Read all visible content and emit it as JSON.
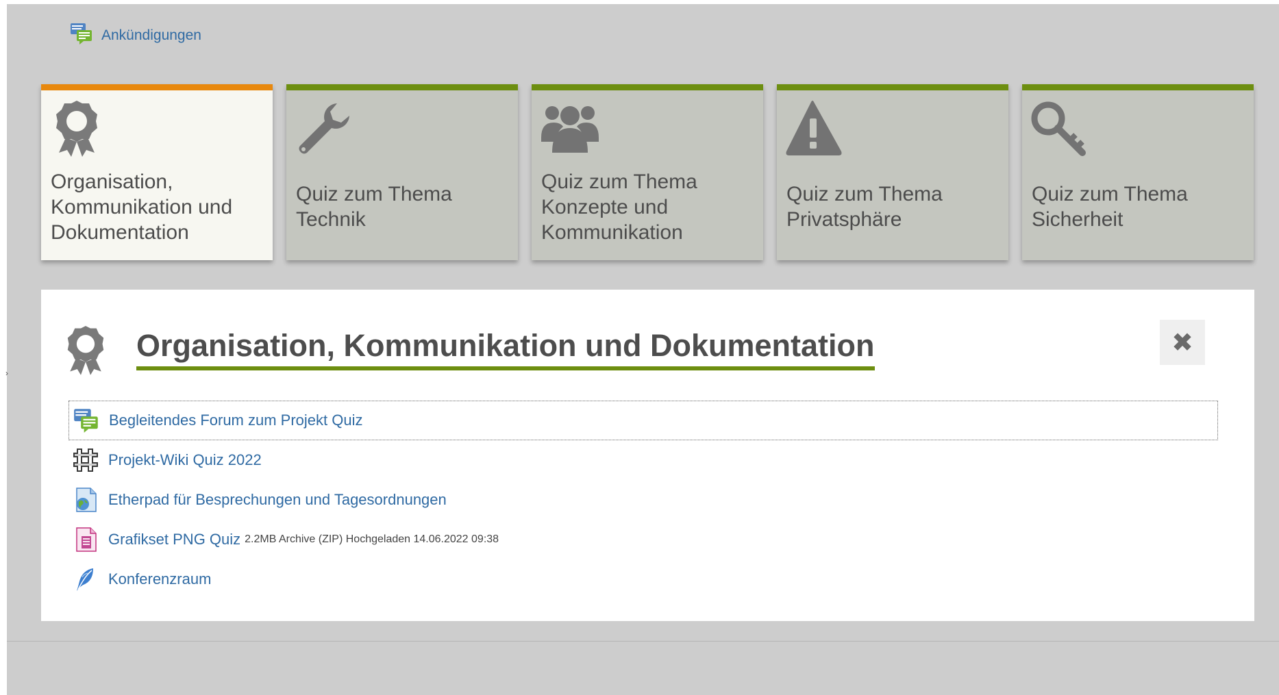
{
  "announcements": {
    "label": "Ankündigungen",
    "icon": "forum-icon"
  },
  "tiles": [
    {
      "label": "Organisation, Kommunikation und Dokumentation",
      "icon": "award-ribbon-icon",
      "active": true
    },
    {
      "label": "Quiz zum Thema Technik",
      "icon": "wrench-icon",
      "active": false
    },
    {
      "label": "Quiz zum Thema Konzepte und Kommunikation",
      "icon": "users-group-icon",
      "active": false
    },
    {
      "label": "Quiz zum Thema Privatsphäre",
      "icon": "warning-triangle-icon",
      "active": false
    },
    {
      "label": "Quiz zum Thema Sicherheit",
      "icon": "key-icon",
      "active": false
    }
  ],
  "panel": {
    "title": "Organisation, Kommunikation und Dokumentation",
    "icon": "award-ribbon-icon",
    "close_label": "✖",
    "activities": [
      {
        "label": "Begleitendes Forum zum Projekt Quiz",
        "icon": "forum-icon",
        "meta": ""
      },
      {
        "label": "Projekt-Wiki Quiz 2022",
        "icon": "wiki-icon",
        "meta": ""
      },
      {
        "label": "Etherpad für Besprechungen und Tagesordnungen",
        "icon": "etherpad-icon",
        "meta": ""
      },
      {
        "label": "Grafikset PNG Quiz",
        "icon": "zip-archive-icon",
        "meta": "2.2MB Archive (ZIP) Hochgeladen 14.06.2022 09:38"
      },
      {
        "label": "Konferenzraum",
        "icon": "conference-feather-icon",
        "meta": ""
      }
    ]
  },
  "colors": {
    "accent_green": "#6d8e10",
    "accent_orange": "#e8880d",
    "link_blue": "#2f6aa3",
    "tile_bg": "#c4c6bf",
    "tile_active_bg": "#f7f7f1",
    "page_bg": "#cdcdcd"
  },
  "stray_mark": "›"
}
